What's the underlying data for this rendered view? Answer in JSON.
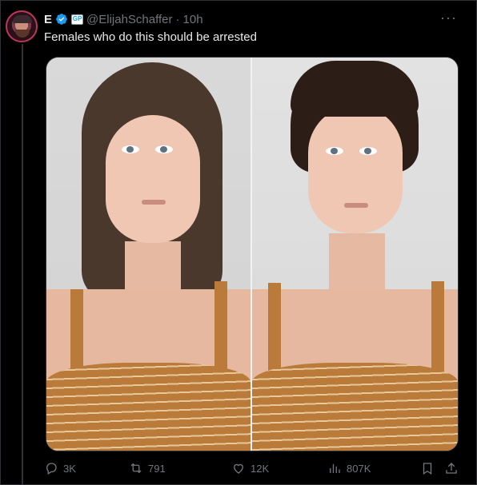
{
  "author": {
    "display_name": "E",
    "handle": "@ElijahSchaffer",
    "separator": "·",
    "time": "10h",
    "affiliation_badge": "GP"
  },
  "tweet": {
    "text": "Females who do this should be arrested"
  },
  "stats": {
    "replies": "3K",
    "reposts": "791",
    "likes": "12K",
    "views": "807K"
  },
  "icons": {
    "more": "more-horizontal-icon",
    "reply": "reply-icon",
    "repost": "repost-icon",
    "like": "heart-icon",
    "views": "views-chart-icon",
    "bookmark": "bookmark-icon",
    "share": "share-icon"
  },
  "colors": {
    "background": "#000000",
    "text": "#e7e9ea",
    "muted": "#71767b",
    "verified": "#1d9bf0",
    "border": "#2f3336"
  }
}
